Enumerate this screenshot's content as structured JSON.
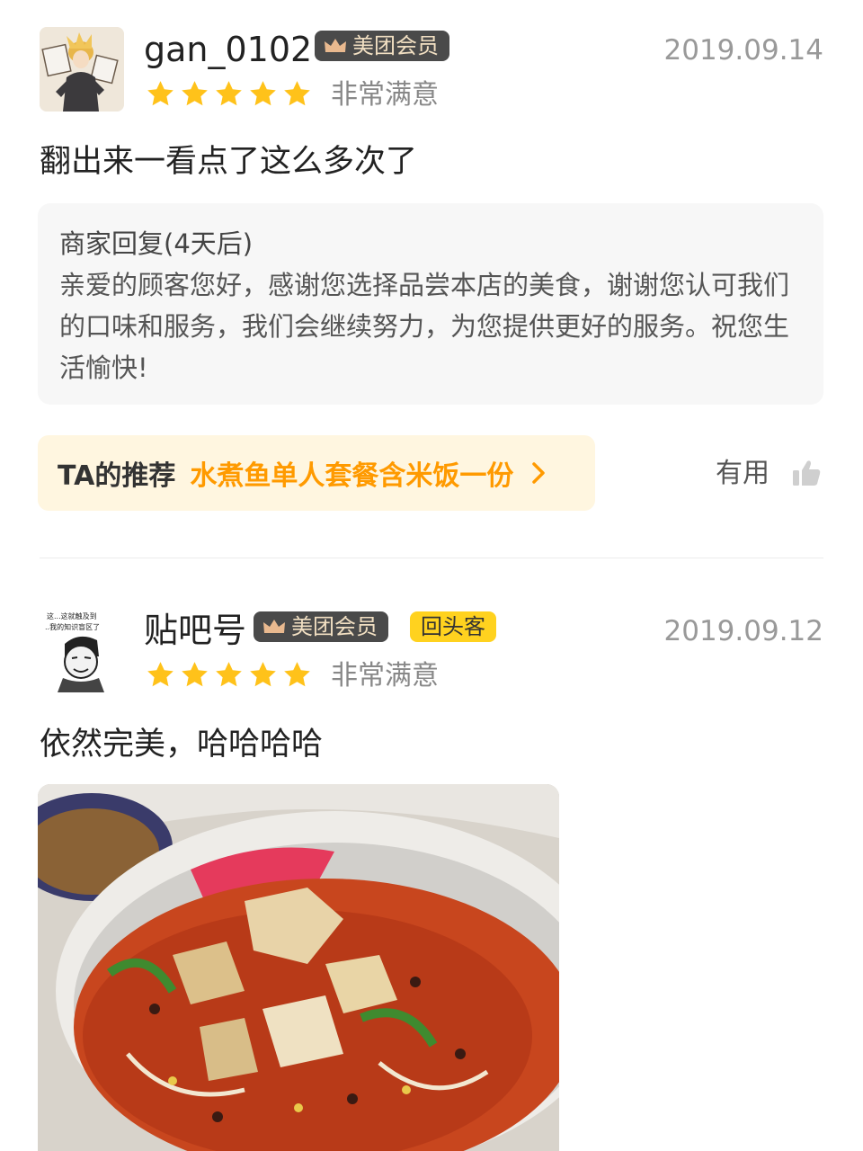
{
  "reviews": [
    {
      "username": "gan_0102",
      "badges": [
        "美团会员"
      ],
      "date": "2019.09.14",
      "stars": 5,
      "rating_text": "非常满意",
      "comment": "翻出来一看点了这么多次了",
      "merchant_reply": {
        "title": "商家回复(4天后)",
        "body": "亲爱的顾客您好，感谢您选择品尝本店的美食，谢谢您认可我们的口味和服务，我们会继续努力，为您提供更好的服务。祝您生活愉快!"
      },
      "recommend": {
        "label": "TA的推荐",
        "dish": "水煮鱼单人套餐含米饭一份"
      },
      "useful_label": "有用"
    },
    {
      "username": "贴吧号",
      "badges": [
        "美团会员",
        "回头客"
      ],
      "avatar_caption": [
        "这...这就触及到",
        "..我的知识盲区了"
      ],
      "date": "2019.09.12",
      "stars": 5,
      "rating_text": "非常满意",
      "comment": "依然完美，哈哈哈哈"
    }
  ],
  "colors": {
    "star": "#ffc21a",
    "vip_badge_bg": "#4a4a4a",
    "vip_badge_text": "#f1dfc2",
    "return_badge_bg": "#ffd21f",
    "recommend_bg": "#fff6e0",
    "recommend_dish": "#ff9a00",
    "reply_bg": "#f7f7f7"
  },
  "icons": {
    "crown": "crown-icon",
    "star": "star-icon",
    "arrow": "chevron-right-icon",
    "thumb": "thumb-up-icon"
  }
}
